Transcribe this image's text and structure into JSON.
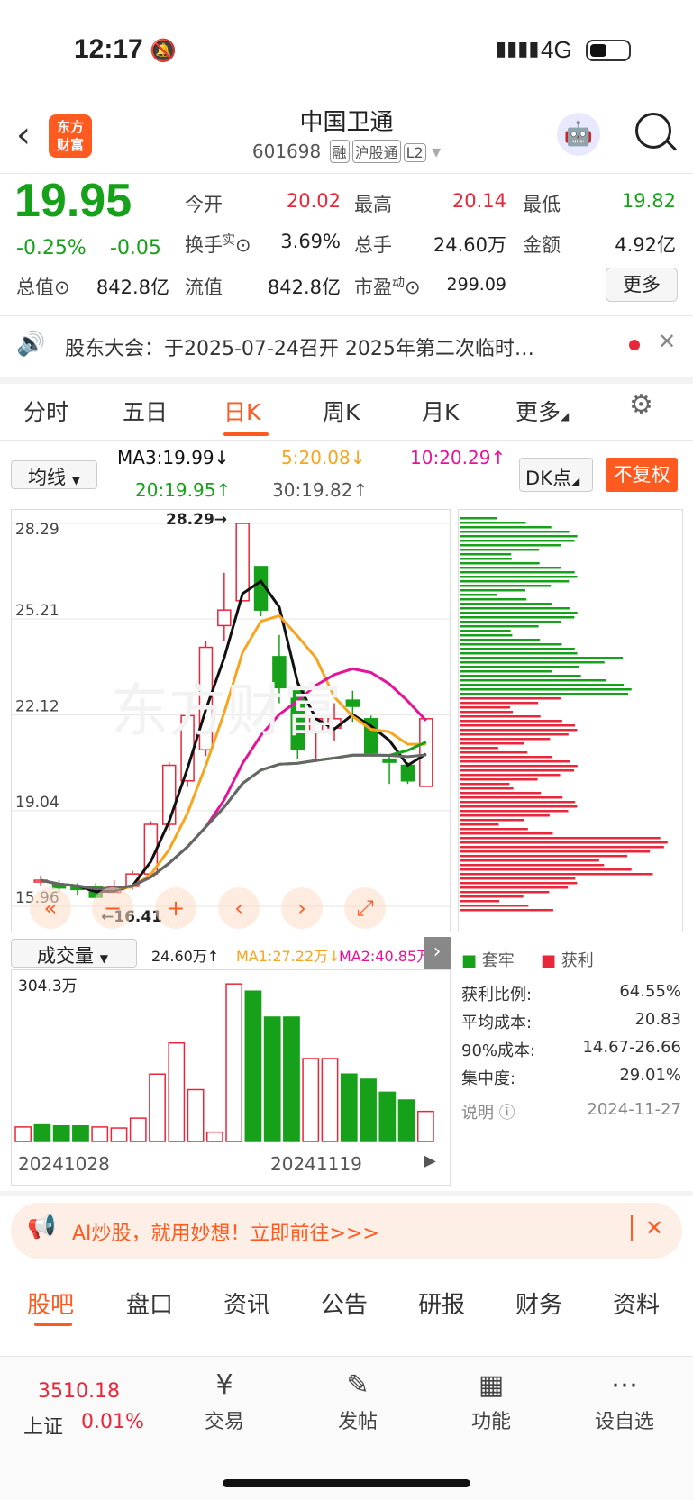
{
  "status": {
    "time": "12:17",
    "network": "4G"
  },
  "header": {
    "title": "中国卫通",
    "code": "601698",
    "tags": [
      "融",
      "沪股通",
      "L2"
    ]
  },
  "quote": {
    "price": "19.95",
    "change_pct": "-0.25%",
    "change": "-0.05",
    "open_label": "今开",
    "open": "20.02",
    "high_label": "最高",
    "high": "20.14",
    "low_label": "最低",
    "low": "19.82",
    "turnover_label": "换手",
    "turnover_sup": "实",
    "turnover": "3.69%",
    "vol_label": "总手",
    "vol": "24.60万",
    "amount_label": "金额",
    "amount": "4.92亿",
    "mcap_label": "总值",
    "mcap": "842.8亿",
    "float_label": "流值",
    "float": "842.8亿",
    "pe_label": "市盈",
    "pe_sup": "动",
    "pe": "299.09",
    "more": "更多"
  },
  "notice": {
    "text": "股东大会：于2025-07-24召开 2025年第二次临时…"
  },
  "tabs": [
    "分时",
    "五日",
    "日K",
    "周K",
    "月K",
    "更多"
  ],
  "chart_toolbar": {
    "ma_select": "均线",
    "ma3": "MA3:19.99↓",
    "ma5": "5:20.08↓",
    "ma10": "10:20.29↑",
    "ma20": "20:19.95↑",
    "ma30": "30:19.82↑",
    "dk": "DK点",
    "fq": "不复权"
  },
  "chart_data": {
    "type": "candlestick",
    "y_ticks": [
      "28.29",
      "25.21",
      "22.12",
      "19.04",
      "15.96"
    ],
    "annotations": {
      "high": "28.29→",
      "low": "←16.41"
    },
    "ylim": [
      15.96,
      28.29
    ],
    "candles": [
      {
        "o": 16.8,
        "c": 16.8,
        "h": 16.95,
        "l": 16.6
      },
      {
        "o": 16.65,
        "c": 16.55,
        "h": 16.8,
        "l": 16.4
      },
      {
        "o": 16.6,
        "c": 16.5,
        "h": 16.7,
        "l": 16.3
      },
      {
        "o": 16.6,
        "c": 16.25,
        "h": 16.7,
        "l": 16.2
      },
      {
        "o": 16.41,
        "c": 16.6,
        "h": 16.8,
        "l": 16.41
      },
      {
        "o": 16.6,
        "c": 17.0,
        "h": 17.1,
        "l": 16.5
      },
      {
        "o": 17.0,
        "c": 18.6,
        "h": 18.7,
        "l": 17.0
      },
      {
        "o": 18.6,
        "c": 20.5,
        "h": 20.6,
        "l": 18.4
      },
      {
        "o": 20.0,
        "c": 22.1,
        "h": 22.1,
        "l": 19.8
      },
      {
        "o": 21.0,
        "c": 24.3,
        "h": 24.5,
        "l": 20.8
      },
      {
        "o": 25.0,
        "c": 25.5,
        "h": 26.7,
        "l": 24.5
      },
      {
        "o": 25.8,
        "c": 28.29,
        "h": 28.29,
        "l": 25.8
      },
      {
        "o": 26.9,
        "c": 25.5,
        "h": 26.9,
        "l": 25.3
      },
      {
        "o": 24.0,
        "c": 23.0,
        "h": 24.7,
        "l": 22.5
      },
      {
        "o": 23.0,
        "c": 21.0,
        "h": 23.1,
        "l": 20.7
      },
      {
        "o": 21.6,
        "c": 22.0,
        "h": 22.1,
        "l": 20.6
      },
      {
        "o": 21.7,
        "c": 22.0,
        "h": 22.5,
        "l": 21.3
      },
      {
        "o": 22.6,
        "c": 22.4,
        "h": 22.9,
        "l": 21.9
      },
      {
        "o": 22.0,
        "c": 20.9,
        "h": 22.1,
        "l": 20.9
      },
      {
        "o": 20.7,
        "c": 20.6,
        "h": 20.8,
        "l": 19.9
      },
      {
        "o": 20.5,
        "c": 20.0,
        "h": 20.6,
        "l": 19.9
      },
      {
        "o": 19.82,
        "c": 22.0,
        "h": 22.0,
        "l": 19.82
      }
    ],
    "ma_series": [
      {
        "name": "MA3",
        "color": "#111111"
      },
      {
        "name": "MA5",
        "color": "#f7a51f"
      },
      {
        "name": "MA10",
        "color": "#e5139a"
      },
      {
        "name": "MA20",
        "color": "#17a11b"
      },
      {
        "name": "MA30",
        "color": "#666666"
      }
    ],
    "volume": {
      "label": "成交量",
      "max_label": "304.3万",
      "vol": "24.60万↑",
      "ma1": "MA1:27.22万↓",
      "ma2": "MA2:40.85万",
      "values": [
        28,
        32,
        30,
        30,
        28,
        26,
        45,
        130,
        190,
        100,
        18,
        304,
        290,
        240,
        240,
        160,
        160,
        130,
        120,
        95,
        80,
        58
      ],
      "dates": [
        "20241028",
        "20241119"
      ]
    }
  },
  "chips": {
    "legend": [
      "套牢",
      "获利"
    ],
    "rows": [
      [
        "获利比例:",
        "64.55%"
      ],
      [
        "平均成本:",
        "20.83"
      ],
      [
        "90%成本:",
        "14.67-26.66"
      ],
      [
        "集中度:",
        "29.01%"
      ]
    ],
    "note": "说明",
    "date": "2024-11-27"
  },
  "ad": {
    "text": "AI炒股，就用妙想！立即前往>>>"
  },
  "bottom_tabs": [
    "股吧",
    "盘口",
    "资讯",
    "公告",
    "研报",
    "财务",
    "资料"
  ],
  "bottom_bar": {
    "index_val": "3510.18",
    "index_name": "上证",
    "index_chg": "0.01%",
    "items": [
      "交易",
      "发帖",
      "功能",
      "设自选"
    ]
  }
}
